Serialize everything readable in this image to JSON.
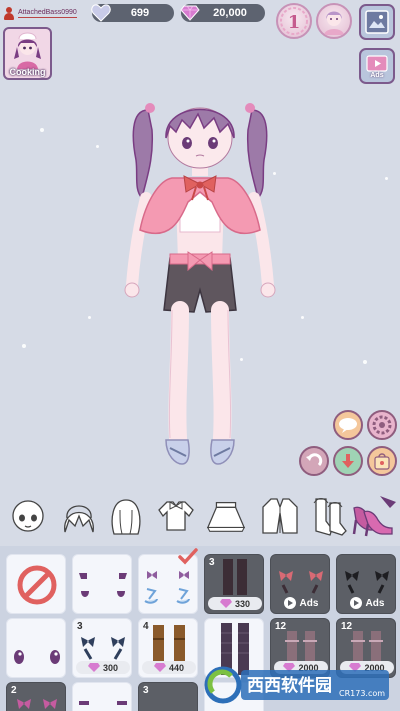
{
  "player": {
    "name": "AttachedBass0990"
  },
  "currency": {
    "hearts": "699",
    "gems": "20,000"
  },
  "badges": {
    "level": "1"
  },
  "buttons": {
    "ads_label": "Ads",
    "cooking_label": "Cooking"
  },
  "categories": [
    "face",
    "front-hair",
    "back-hair",
    "top",
    "skirt",
    "jacket",
    "socks",
    "shoes"
  ],
  "items": [
    {
      "id": "none",
      "style": "light",
      "selected": false
    },
    {
      "id": "eyes-1",
      "style": "light",
      "selected": false
    },
    {
      "id": "socks-bow",
      "style": "light",
      "selected": true
    },
    {
      "id": "stockings-black",
      "style": "dark",
      "count": "3",
      "price": "330"
    },
    {
      "id": "bow-pink",
      "style": "dark",
      "ads": "Ads"
    },
    {
      "id": "bow-black",
      "style": "dark",
      "ads": "Ads"
    },
    {
      "id": "eyes-2",
      "style": "light"
    },
    {
      "id": "bow-navy",
      "style": "light",
      "count": "3",
      "price": "300"
    },
    {
      "id": "boots-brown",
      "style": "light",
      "count": "4",
      "price": "440"
    },
    {
      "id": "stockings-purple",
      "style": "light"
    },
    {
      "id": "garter-1",
      "style": "dark",
      "count": "12",
      "price": "2000"
    },
    {
      "id": "garter-2",
      "style": "dark",
      "count": "12",
      "price": "2000"
    },
    {
      "id": "row3-1",
      "style": "light",
      "count": "2"
    },
    {
      "id": "row3-2",
      "style": "light"
    },
    {
      "id": "row3-3",
      "style": "light",
      "count": "3"
    }
  ],
  "watermark": {
    "brand": "西西软件园",
    "url": "CR173.com"
  },
  "colors": {
    "accent": "#c55b8e",
    "panel": "#5c5f66",
    "background": "#d6dbe6"
  }
}
